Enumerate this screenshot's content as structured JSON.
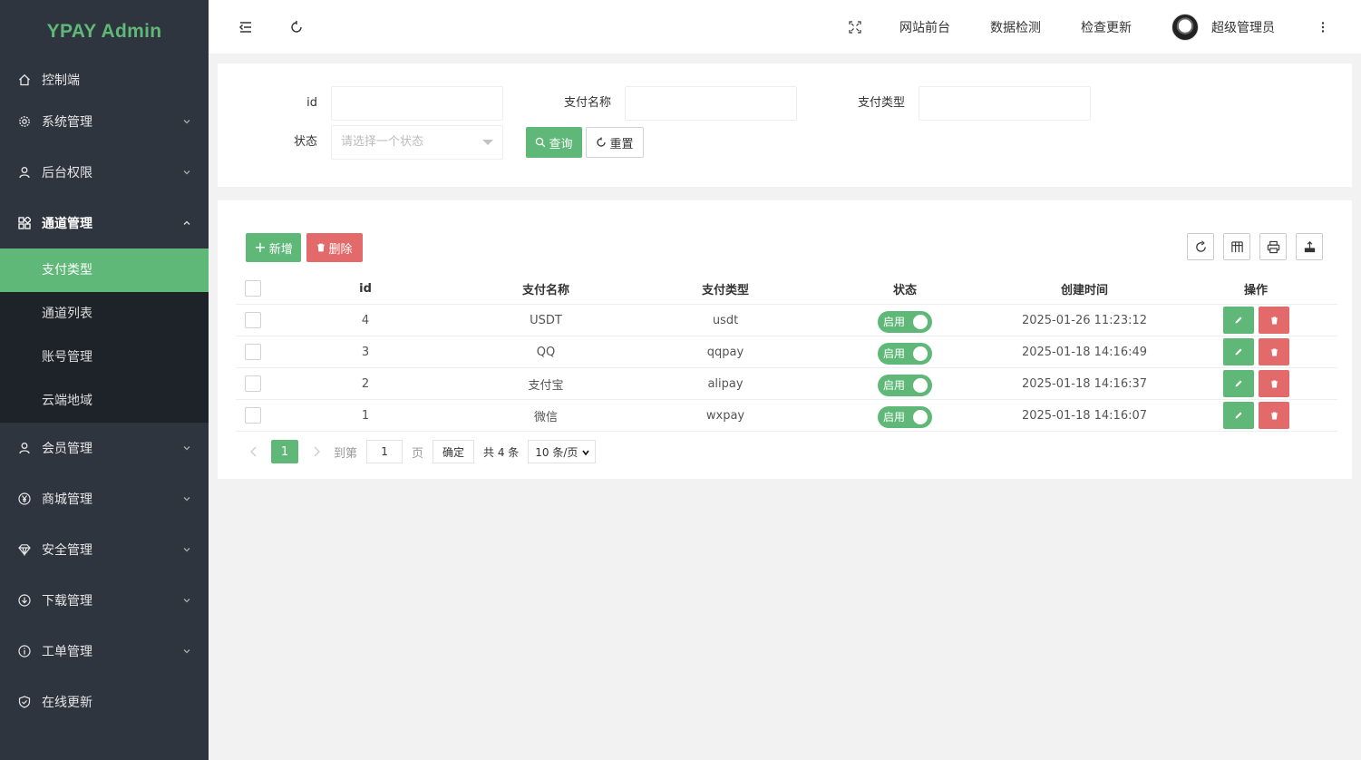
{
  "app": {
    "logo": "YPAY Admin"
  },
  "sidebar": {
    "items": [
      {
        "label": "控制端",
        "icon": "home-icon"
      },
      {
        "label": "系统管理",
        "icon": "gear-icon"
      },
      {
        "label": "后台权限",
        "icon": "user-icon"
      },
      {
        "label": "通道管理",
        "icon": "apps-icon"
      },
      {
        "label": "会员管理",
        "icon": "user-icon"
      },
      {
        "label": "商城管理",
        "icon": "yen-icon"
      },
      {
        "label": "安全管理",
        "icon": "diamond-icon"
      },
      {
        "label": "下载管理",
        "icon": "download-icon"
      },
      {
        "label": "工单管理",
        "icon": "info-icon"
      },
      {
        "label": "在线更新",
        "icon": "shield-icon"
      }
    ],
    "submenu": [
      "支付类型",
      "通道列表",
      "账号管理",
      "云端地域"
    ],
    "active_submenu": "支付类型"
  },
  "header": {
    "links": [
      "网站前台",
      "数据检测",
      "检查更新"
    ],
    "user": "超级管理员"
  },
  "search": {
    "id_label": "id",
    "name_label": "支付名称",
    "type_label": "支付类型",
    "status_label": "状态",
    "status_placeholder": "请选择一个状态",
    "query_button": "查询",
    "reset_button": "重置"
  },
  "toolbar": {
    "add_button": "新增",
    "delete_button": "删除"
  },
  "table": {
    "columns": [
      "id",
      "支付名称",
      "支付类型",
      "状态",
      "创建时间",
      "操作"
    ],
    "rows": [
      {
        "id": "4",
        "name": "USDT",
        "type": "usdt",
        "status": "启用",
        "created": "2025-01-26 11:23:12"
      },
      {
        "id": "3",
        "name": "QQ",
        "type": "qqpay",
        "status": "启用",
        "created": "2025-01-18 14:16:49"
      },
      {
        "id": "2",
        "name": "支付宝",
        "type": "alipay",
        "status": "启用",
        "created": "2025-01-18 14:16:37"
      },
      {
        "id": "1",
        "name": "微信",
        "type": "wxpay",
        "status": "启用",
        "created": "2025-01-18 14:16:07"
      }
    ]
  },
  "pager": {
    "current_page": "1",
    "goto_label": "到第",
    "goto_value": "1",
    "page_label": "页",
    "confirm": "确定",
    "total": "共 4 条",
    "page_size": "10 条/页"
  },
  "colors": {
    "accent": "#5fb878",
    "danger": "#e26a6a",
    "sidebar": "#2f353e",
    "sidebar_sub": "#1e2329"
  }
}
